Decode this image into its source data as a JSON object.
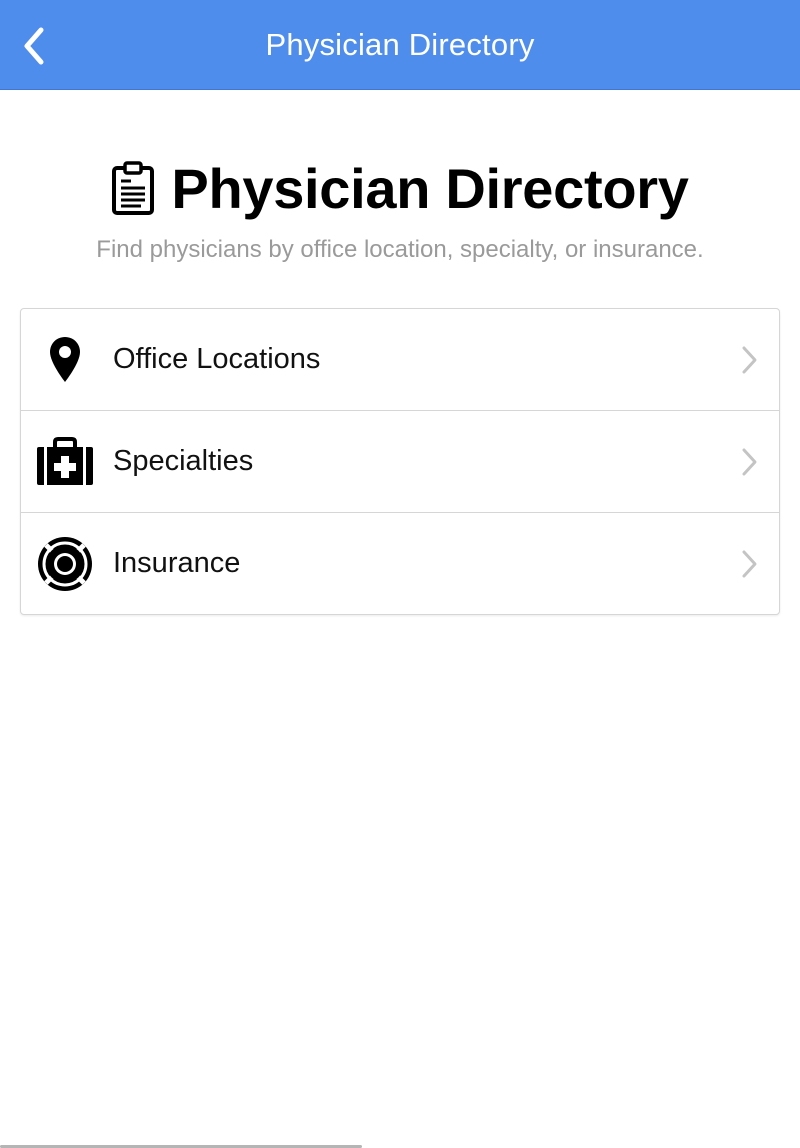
{
  "navbar": {
    "title": "Physician Directory",
    "back_icon": "chevron-left-icon",
    "background": "#4f8ded"
  },
  "header": {
    "icon": "clipboard-icon",
    "title": "Physician Directory",
    "subtitle": "Find physicians by office location, specialty, or insurance."
  },
  "menu": {
    "items": [
      {
        "label": "Office Locations",
        "icon": "map-marker-icon"
      },
      {
        "label": "Specialties",
        "icon": "medkit-icon"
      },
      {
        "label": "Insurance",
        "icon": "life-ring-icon"
      }
    ],
    "chevron_icon": "chevron-right-icon"
  }
}
